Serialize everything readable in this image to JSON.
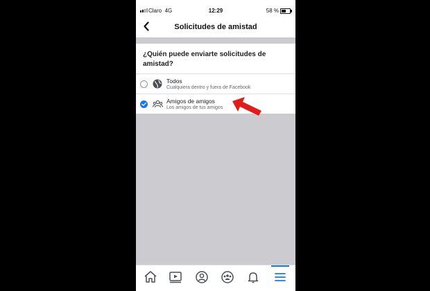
{
  "status_bar": {
    "carrier": "Claro",
    "network": "4G",
    "time": "12:29",
    "battery": "58 %"
  },
  "header": {
    "title": "Solicitudes de amistad",
    "back_icon": "chevron-left-icon"
  },
  "question": "¿Quién puede enviarte solicitudes de amistad?",
  "options": [
    {
      "title": "Todos",
      "subtitle": "Cualquiera dentro y fuera de Facebook",
      "icon": "globe-icon",
      "selected": false
    },
    {
      "title": "Amigos de amigos",
      "subtitle": "Los amigos de tus amigos",
      "icon": "friends-icon",
      "selected": true
    }
  ],
  "tabbar": {
    "items": [
      "home-icon",
      "video-icon",
      "profile-icon",
      "groups-icon",
      "bell-icon",
      "menu-icon"
    ],
    "active": "menu-icon"
  },
  "colors": {
    "accent": "#1877f2",
    "annotation": "#e31b1b",
    "gray": "#ccccd0"
  }
}
